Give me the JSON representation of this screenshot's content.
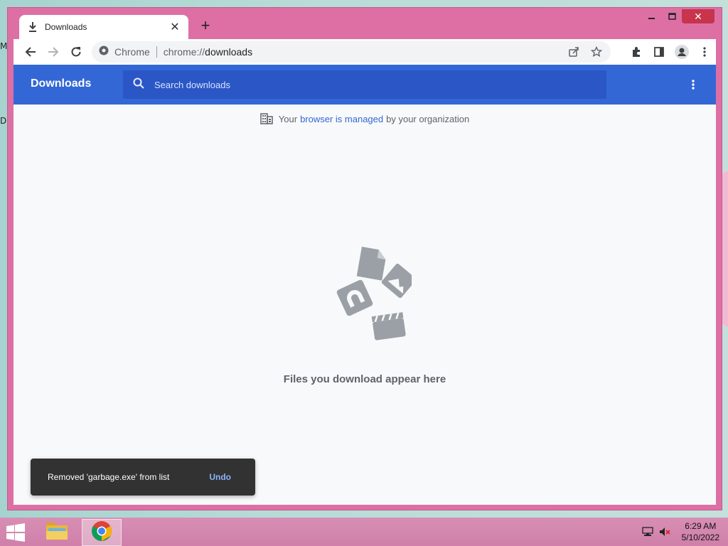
{
  "desktop": {
    "edge_labels": [
      "M",
      "D"
    ]
  },
  "browser": {
    "tab": {
      "title": "Downloads",
      "icon": "download-icon"
    },
    "window_controls": {
      "minimize": "minimize-icon",
      "maximize": "maximize-icon",
      "close": "close-icon"
    },
    "toolbar": {
      "omnibox": {
        "site_label": "Chrome",
        "url_scheme": "chrome://",
        "url_path": "downloads"
      }
    }
  },
  "downloads_page": {
    "title": "Downloads",
    "search": {
      "placeholder": "Search downloads",
      "value": ""
    },
    "managed_notice": {
      "prefix": "Your",
      "link": "browser is managed",
      "suffix": "by your organization"
    },
    "empty_message": "Files you download appear here",
    "toast": {
      "message": "Removed 'garbage.exe' from list",
      "action": "Undo"
    }
  },
  "colors": {
    "header_blue": "#3367d6",
    "search_blue": "#2a56c6",
    "window_frame": "#dd6fa4",
    "toast_bg": "#323232",
    "toast_action": "#8ab4f8"
  },
  "taskbar": {
    "apps": [
      {
        "name": "file-explorer",
        "icon": "folder-icon",
        "active": false
      },
      {
        "name": "chrome",
        "icon": "chrome-icon",
        "active": true
      }
    ],
    "clock": {
      "time": "6:29 AM",
      "date": "5/10/2022"
    }
  }
}
